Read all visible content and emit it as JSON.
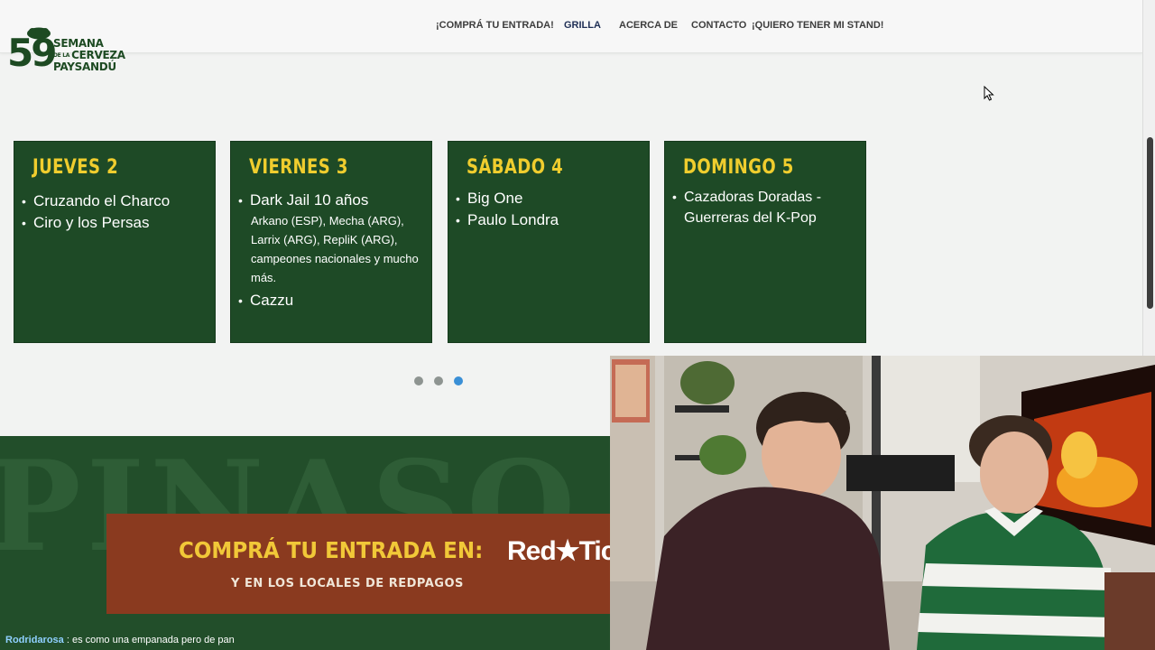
{
  "header": {
    "logo": {
      "number": "59",
      "line1": "SEMANA",
      "line2_small": "DE LA",
      "line2": "CERVEZA",
      "line3": "PAYSANDÚ"
    },
    "nav": [
      {
        "label": "¡COMPRÁ TU ENTRADA!",
        "active": false
      },
      {
        "label": "GRILLA",
        "active": true
      },
      {
        "label": "ACERCA DE",
        "active": false
      },
      {
        "label": "CONTACTO",
        "active": false
      },
      {
        "label": "¡QUIERO TENER MI STAND!",
        "active": false
      }
    ]
  },
  "lineup": [
    {
      "day": "JUEVES 2",
      "items": [
        {
          "text": "Cruzando el Charco"
        },
        {
          "text": "Ciro y los Persas"
        }
      ]
    },
    {
      "day": "VIERNES 3",
      "items": [
        {
          "text": "Dark Jail 10 años"
        },
        {
          "text": "Arkano (ESP), Mecha (ARG), Larrix (ARG), RepliK (ARG), campeones nacionales y mucho más.",
          "sub": true
        },
        {
          "text": "Cazzu"
        }
      ]
    },
    {
      "day": "SÁBADO 4",
      "items": [
        {
          "text": "Big One"
        },
        {
          "text": "Paulo Londra"
        }
      ]
    },
    {
      "day": "DOMINGO 5",
      "items": [
        {
          "text": "Cazadoras Doradas - Guerreras del K-Pop"
        }
      ]
    }
  ],
  "carousel": {
    "total": 3,
    "active_index": 2
  },
  "promo": {
    "background_text": "PINASO",
    "main_text": "COMPRÁ TU ENTRADA EN:",
    "brand": "RedTickets",
    "brand_visible": "Red★Tic",
    "sub_text": "Y EN LOS LOCALES DE REDPAGOS"
  },
  "chat": {
    "user": "Rodridarosa",
    "message": ": es como una empanada pero de pan"
  },
  "colors": {
    "card_bg": "#1e4a26",
    "card_title": "#f0cd2e",
    "nav_active": "#1f2f55",
    "dot_active": "#3a8fd6",
    "promo_box": "#8a3a1f"
  },
  "icons": [
    "tree-icon",
    "mouse-cursor-icon",
    "star-icon"
  ]
}
